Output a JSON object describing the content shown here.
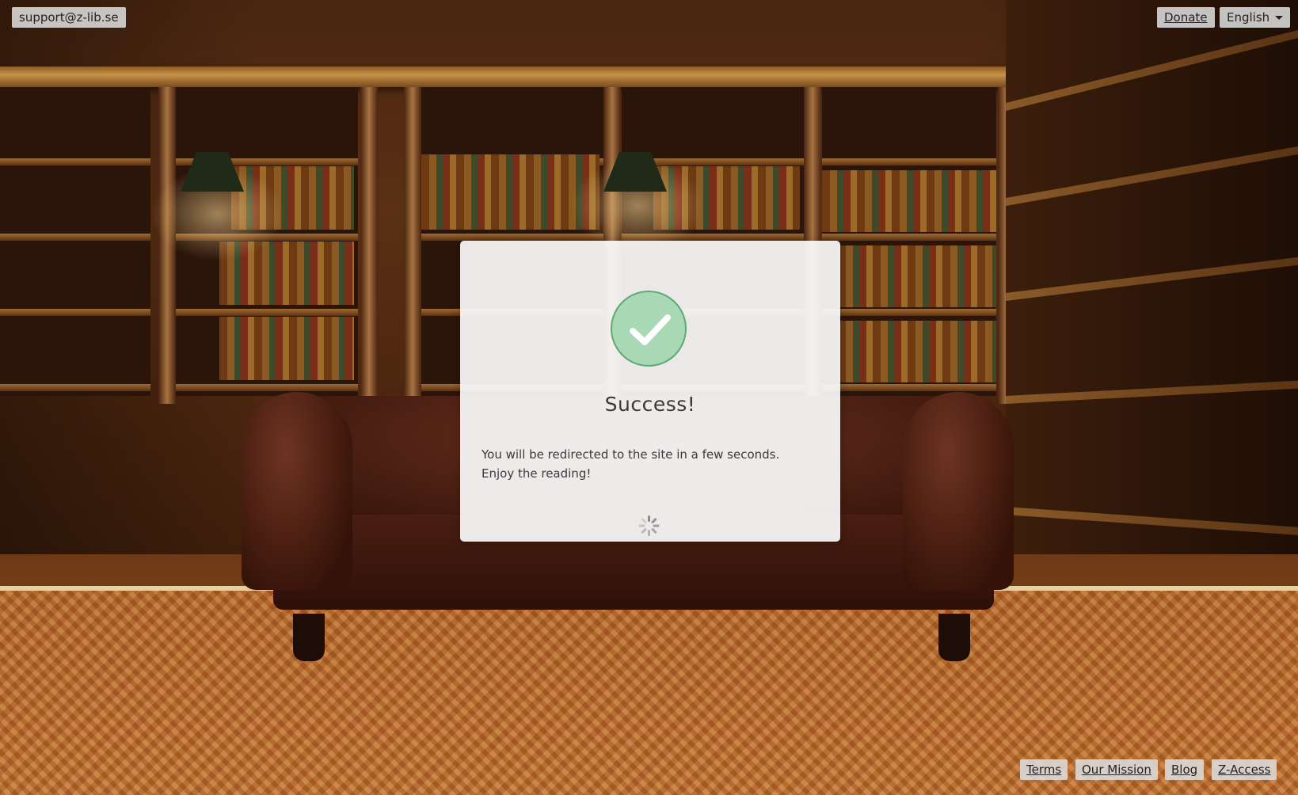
{
  "header": {
    "support_email": "support@z-lib.se",
    "donate_label": "Donate",
    "language": {
      "selected": "English"
    }
  },
  "modal": {
    "icon": "check-icon",
    "title": "Success!",
    "message": "You will be redirected to the site in a few seconds. Enjoy the reading!",
    "spinner": "loading-spinner-icon",
    "success_color": "#a9d8b4"
  },
  "footer": {
    "links": [
      "Terms",
      "Our Mission",
      "Blog",
      "Z-Access"
    ]
  }
}
